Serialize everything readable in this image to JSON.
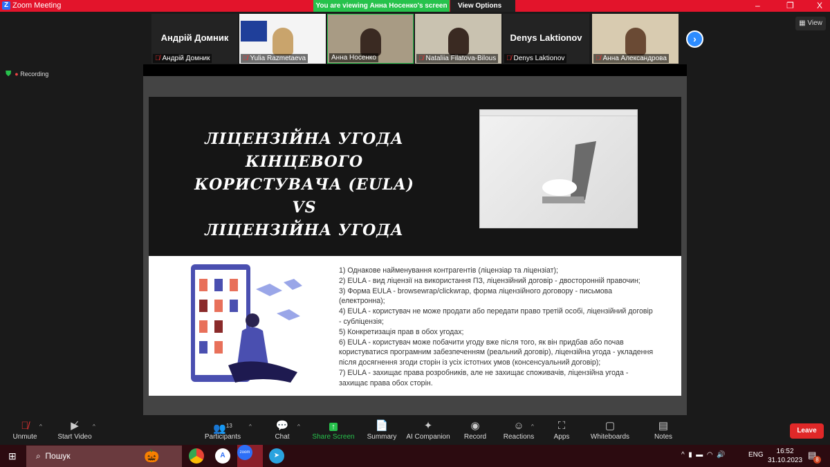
{
  "window": {
    "title": "Zoom Meeting",
    "logo": "Z",
    "banner": "You are viewing Анна Носенко's screen",
    "view_options": "View Options",
    "minimize": "–",
    "maximize": "❐",
    "close": "X"
  },
  "participants_strip": [
    {
      "name": "Андрій Домник",
      "big_label": "Андрій Домник",
      "muted": true
    },
    {
      "name": "Yulia Razmetaeva",
      "muted": true
    },
    {
      "name": "Анна Носенко",
      "muted": false
    },
    {
      "name": "Nataliia Filatova-Bilous",
      "muted": true
    },
    {
      "name": "Denys Laktionov",
      "big_label": "Denys Laktionov",
      "muted": true
    },
    {
      "name": "Анна Александрова",
      "muted": true
    }
  ],
  "view_button": "View",
  "recording": "Recording",
  "slide": {
    "title_lines": [
      "ЛІЦЕНЗІЙНА УГОДА КІНЦЕВОГО",
      "КОРИСТУВАЧА (EULA)",
      "VS",
      "ЛІЦЕНЗІЙНА УГОДА"
    ],
    "points": [
      "1) Однакове найменування контрагентів (ліцензіар та ліцензіат);",
      "2) EULA - вид ліцензії на використання ПЗ, ліцензійний договір - двосторонній правочин;",
      "3) Форма EULA - browsewrap/clickwrap, форма ліцензійного договору - письмова (електронна);",
      "4) EULA - користувач не може продати або передати право третій особі, ліцензійний договір - субліцензія;",
      "5) Конкретизація прав в обох угодах;",
      "6) EULA - користувач може побачити угоду вже після того, як він придбав або почав користуватися програмним забезпеченням (реальний договір), ліцензійна угода - укладення після досягнення згоди сторін із усіх істотних умов (консенсуальний договір);",
      "7) EULA - захищає права розробників, але не захищає споживачів, ліцензійна угода - захищає права обох сторін."
    ]
  },
  "toolbar": {
    "unmute": "Unmute",
    "start_video": "Start Video",
    "participants": "Participants",
    "participants_count": "13",
    "chat": "Chat",
    "share_screen": "Share Screen",
    "summary": "Summary",
    "ai_companion": "AI Companion",
    "record": "Record",
    "reactions": "Reactions",
    "apps": "Apps",
    "whiteboards": "Whiteboards",
    "notes": "Notes",
    "leave": "Leave"
  },
  "taskbar": {
    "search_placeholder": "Пошук",
    "language": "ENG",
    "time": "16:52",
    "date": "31.10.2023",
    "notifications": "8"
  },
  "colors": {
    "titlebar": "#e3142b",
    "banner": "#27c24c",
    "accent": "#2d8cff",
    "leave": "#e02828"
  }
}
